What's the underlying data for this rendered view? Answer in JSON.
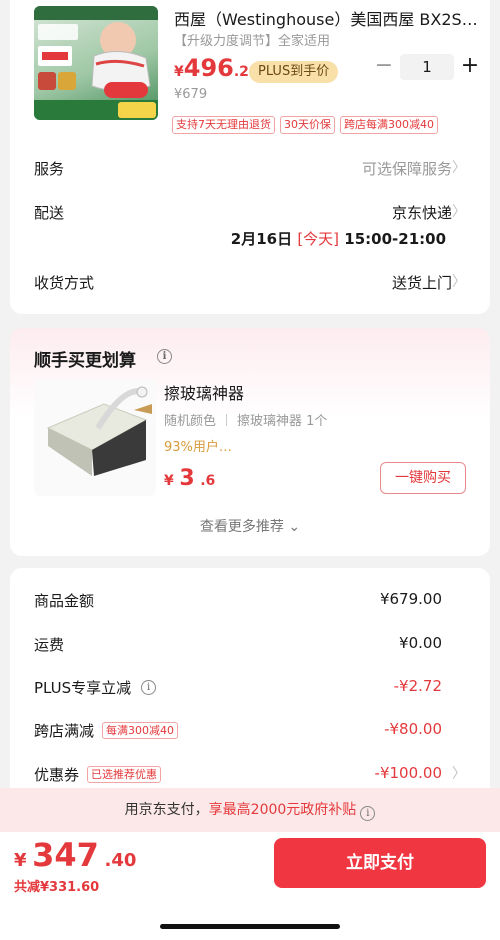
{
  "product": {
    "title": "西屋（Westinghouse）美国西屋 BX2S…",
    "spec": "【升级力度调节】全家适用",
    "price_currency": "¥",
    "price_int": "496",
    "price_dec": ".28",
    "plus_badge": "PLUS到手价",
    "original_price": "¥679",
    "quantity": "1",
    "minus_label": "−",
    "plus_label": "+",
    "tags": [
      "支持7天无理由退货",
      "30天价保",
      "跨店每满300减40"
    ]
  },
  "service": {
    "label": "服务",
    "value": "可选保障服务"
  },
  "delivery": {
    "label": "配送",
    "value": "京东快递",
    "date": "2月16日",
    "today": "[今天]",
    "time": "15:00-21:00"
  },
  "receive": {
    "label": "收货方式",
    "value": "送货上门"
  },
  "recommend": {
    "title": "顺手买更划算",
    "item_name": "擦玻璃神器",
    "item_color": "随机颜色",
    "item_desc": "擦玻璃神器 1个",
    "item_rating": "93%用户…",
    "price_currency": "¥",
    "price_int": "3",
    "price_dec": ".6",
    "buy_label": "一键购买",
    "more_label": "查看更多推荐 ⌄"
  },
  "price_detail": {
    "goods_label": "商品金额",
    "goods_value": "¥679.00",
    "shipping_label": "运费",
    "shipping_value": "¥0.00",
    "plus_label": "PLUS专享立减",
    "plus_value": "-¥2.72",
    "cross_label": "跨店满减",
    "cross_tag": "每满300减40",
    "cross_value": "-¥80.00",
    "coupon_label": "优惠券",
    "coupon_tag": "已选推荐优惠",
    "coupon_value": "-¥100.00"
  },
  "subsidy": {
    "prefix": "用京东支付，",
    "highlight": "享最高2000元政府补贴"
  },
  "footer": {
    "total_currency": "¥",
    "total_int": "347",
    "total_dec": ".40",
    "saved": "共减¥331.60",
    "pay_label": "立即支付"
  },
  "icons": {
    "chevron": "chevron-right-icon",
    "info": "info-icon"
  },
  "colors": {
    "accent": "#e4393c",
    "pay_button": "#f03641",
    "plus_badge": "#f8e0a8"
  }
}
